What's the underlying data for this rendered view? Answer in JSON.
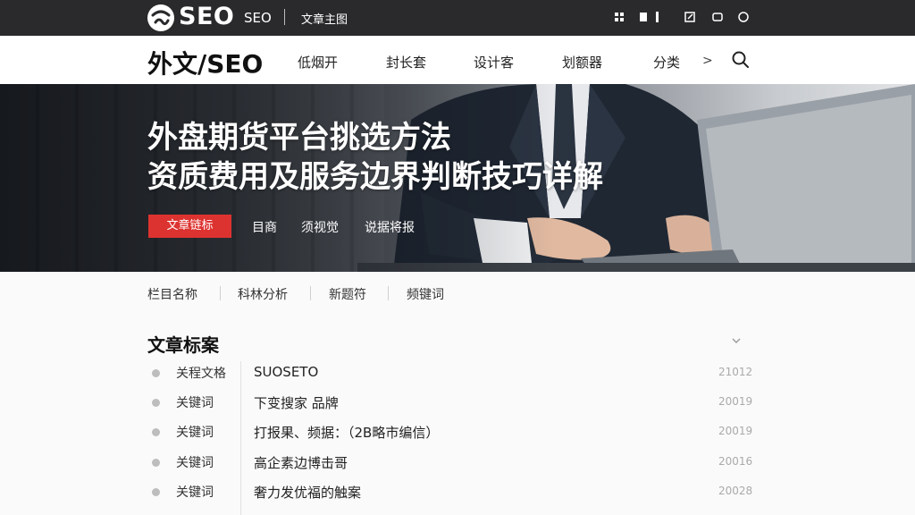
{
  "topbar": {
    "logo_text": "SEO",
    "sub_label": "SEO",
    "link": "文章主图",
    "icons": [
      "grid-icon",
      "bookmark-icon",
      "share-icon",
      "window-icon",
      "search-circle-icon"
    ]
  },
  "nav": {
    "brand": "外文/SEO",
    "items": [
      "低烟开",
      "封长套",
      "设计客",
      "划额器",
      "分类"
    ],
    "more": ">"
  },
  "hero": {
    "title_line1": "外盘期货平台挑选方法",
    "title_line2": "资质费用及服务边界判断技巧详解",
    "badge": "文章链标",
    "tags": [
      "目商",
      "须视觉",
      "说据将报"
    ]
  },
  "filters": [
    "栏目名称",
    "科林分析",
    "新题符",
    "频键词"
  ],
  "section": {
    "title": "文章标案",
    "rows": [
      {
        "key": "关程文格",
        "value": "SUOSETO",
        "num": "21012"
      },
      {
        "key": "关键词",
        "value": "下变搜家 品牌",
        "num": "20019"
      },
      {
        "key": "关键词",
        "value": "打报果、频据：（2B略市编信）",
        "num": "20019"
      },
      {
        "key": "关键词",
        "value": "高企素边博击哥",
        "num": "20016"
      },
      {
        "key": "关键词",
        "value": "奢力发优福的触案",
        "num": "20028"
      }
    ]
  },
  "colors": {
    "accent": "#dd3330",
    "topbar": "#2a2a2c"
  }
}
